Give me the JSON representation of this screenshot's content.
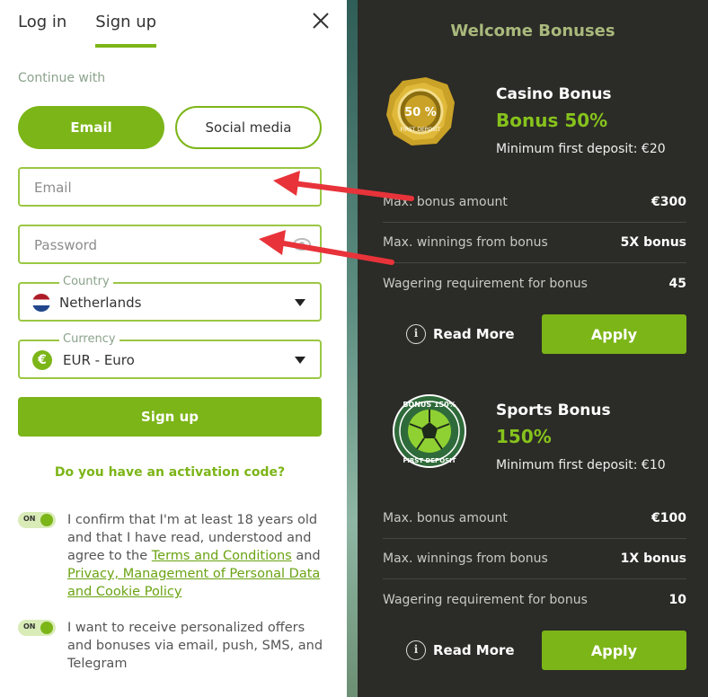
{
  "auth": {
    "tabs": [
      {
        "label": "Log in"
      },
      {
        "label": "Sign up"
      }
    ],
    "continue_with": "Continue with",
    "methods": {
      "email": "Email",
      "social": "Social media"
    },
    "email_placeholder": "Email",
    "password_placeholder": "Password",
    "country": {
      "legend": "Country",
      "value": "Netherlands"
    },
    "currency": {
      "legend": "Currency",
      "value": "EUR - Euro",
      "symbol": "€"
    },
    "signup_label": "Sign up",
    "activation_label": "Do you have an activation code?",
    "consents": [
      {
        "toggle": "ON",
        "text_before": "I confirm that I'm at least 18 years old and that I have read, understood and agree to the ",
        "link1": "Terms and Conditions",
        "text_mid": " and ",
        "link2": "Privacy, Management of Personal Data and Cookie Policy"
      },
      {
        "toggle": "ON",
        "text": "I want to receive personalized offers and bonuses via email, push, SMS, and Telegram"
      }
    ]
  },
  "bonuses": {
    "title": "Welcome Bonuses",
    "items": [
      {
        "name": "Casino Bonus",
        "percent": "Bonus 50%",
        "min_deposit": "Minimum first deposit: €20",
        "badge_text": "50 %",
        "badge_sub": "FIRST DEPOSIT",
        "rows": [
          {
            "label": "Max. bonus amount",
            "value": "€300"
          },
          {
            "label": "Max. winnings from bonus",
            "value": "5X bonus"
          },
          {
            "label": "Wagering requirement for bonus",
            "value": "45"
          }
        ],
        "read_more": "Read More",
        "apply": "Apply"
      },
      {
        "name": "Sports Bonus",
        "percent": "150%",
        "min_deposit": "Minimum first deposit: €10",
        "badge_text": "BONUS 150%",
        "badge_sub": "FIRST DEPOSIT",
        "rows": [
          {
            "label": "Max. bonus amount",
            "value": "€100"
          },
          {
            "label": "Max. winnings from bonus",
            "value": "1X bonus"
          },
          {
            "label": "Wagering requirement for bonus",
            "value": "10"
          }
        ],
        "read_more": "Read More",
        "apply": "Apply"
      }
    ]
  },
  "colors": {
    "accent": "#7cb518",
    "panel_dark": "#2b2b27",
    "arrow": "#e8333a"
  }
}
